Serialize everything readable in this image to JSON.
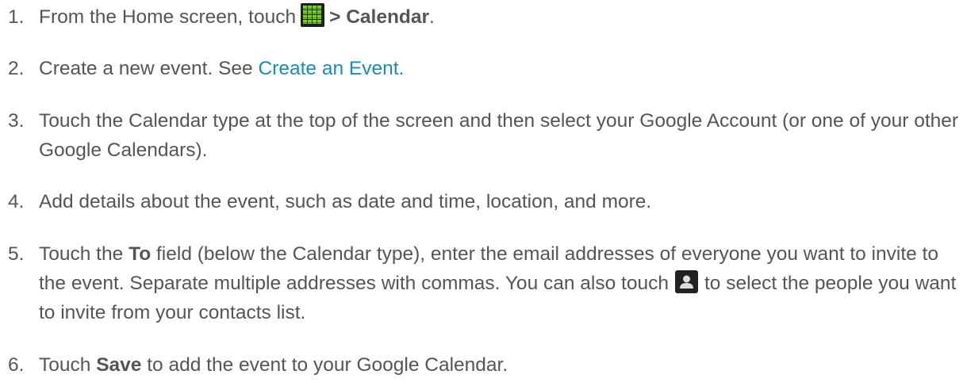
{
  "steps": [
    {
      "num": "1.",
      "before": "From the Home screen, touch",
      "icon": "apps-grid-icon",
      "bold": "> Calendar",
      "after": "."
    },
    {
      "num": "2.",
      "before": "Create a new event. See ",
      "link": "Create an Event",
      "after": "."
    },
    {
      "num": "3.",
      "text": "Touch the Calendar type at the top of the screen and then select your Google Account (or one of your other Google Calendars)."
    },
    {
      "num": "4.",
      "text": "Add details about the event, such as date and time, location, and more."
    },
    {
      "num": "5.",
      "before": "Touch the ",
      "bold": "To",
      "middle": " field (below the Calendar type), enter the email addresses of everyone you want to invite to the event. Separate multiple addresses with commas. You can also touch",
      "icon": "contact-person-icon",
      "after": "to select the people you want to invite from your contacts list."
    },
    {
      "num": "6.",
      "before": "Touch ",
      "bold": "Save",
      "after": " to add the event to your Google Calendar."
    }
  ],
  "colors": {
    "text": "#555555",
    "link": "#1b8bb8"
  }
}
